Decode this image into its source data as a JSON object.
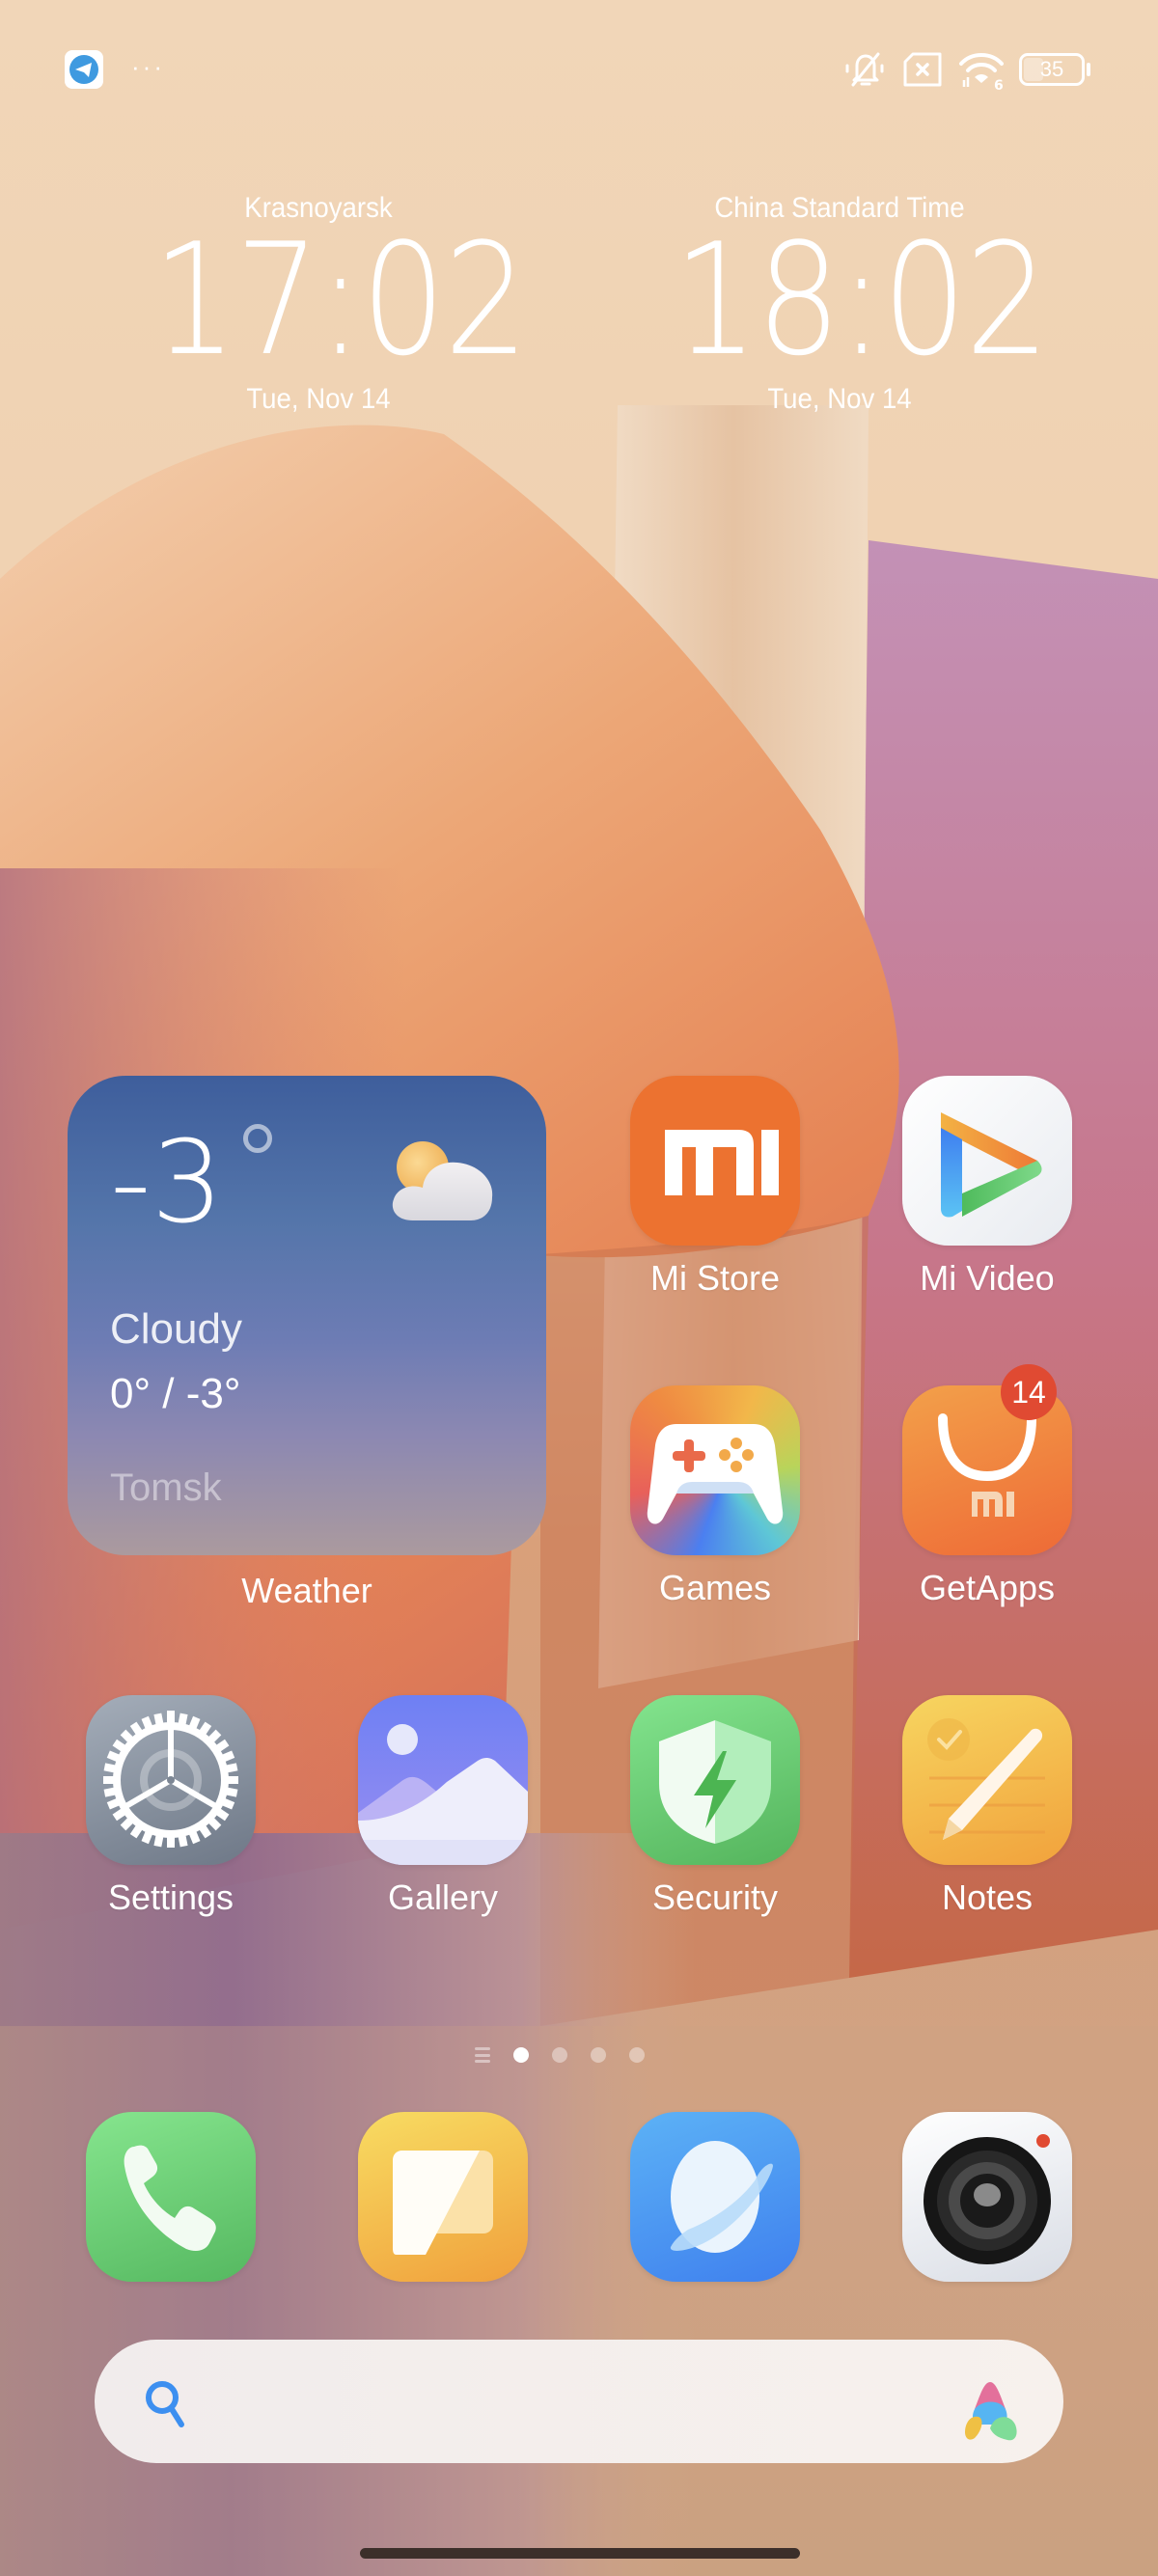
{
  "status_bar": {
    "notification_icons": [
      "telegram-icon",
      "more-notifications-icon"
    ],
    "more_indicator": "···",
    "system_icons": [
      "silent-mode-icon",
      "no-sim-icon",
      "wifi-6-icon",
      "battery-icon"
    ],
    "wifi_generation": "6",
    "battery_level": "35",
    "battery_fraction": 0.35
  },
  "clocks": [
    {
      "city": "Krasnoyarsk",
      "time": "17:02",
      "date": "Tue, Nov 14"
    },
    {
      "city": "China Standard Time",
      "time": "18:02",
      "date": "Tue, Nov 14"
    }
  ],
  "weather_widget": {
    "temperature": "-3",
    "condition": "Cloudy",
    "range": "0° / -3°",
    "location": "Tomsk",
    "icon": "partly-cloudy-icon",
    "label": "Weather"
  },
  "apps": [
    {
      "label": "Mi Store",
      "icon": "mi-store-icon"
    },
    {
      "label": "Mi Video",
      "icon": "mi-video-icon"
    },
    {
      "label": "Games",
      "icon": "games-icon"
    },
    {
      "label": "GetApps",
      "icon": "getapps-icon",
      "badge": "14"
    },
    {
      "label": "Settings",
      "icon": "settings-icon"
    },
    {
      "label": "Gallery",
      "icon": "gallery-icon"
    },
    {
      "label": "Security",
      "icon": "security-icon"
    },
    {
      "label": "Notes",
      "icon": "notes-icon"
    }
  ],
  "page_indicator": {
    "pages": 4,
    "active": 1
  },
  "dock": [
    {
      "name": "Phone",
      "icon": "phone-icon"
    },
    {
      "name": "Messaging",
      "icon": "messaging-icon"
    },
    {
      "name": "Browser",
      "icon": "browser-icon"
    },
    {
      "name": "Camera",
      "icon": "camera-icon"
    }
  ],
  "search_bar": {
    "placeholder": ""
  },
  "colors": {
    "badge": "#e04a32",
    "search_icon": "#3d8ff0",
    "mi_orange": "#ec7230"
  }
}
